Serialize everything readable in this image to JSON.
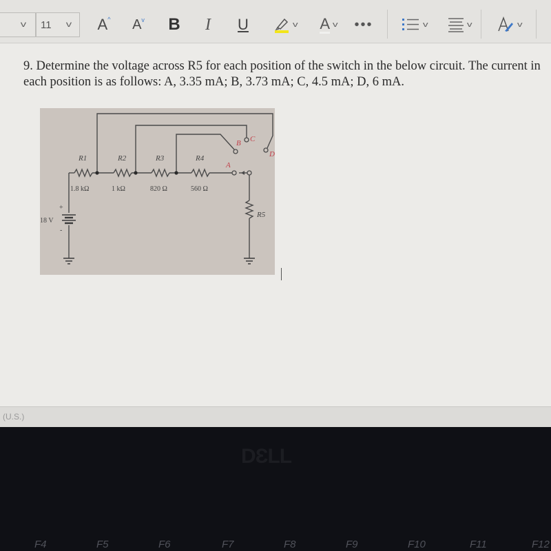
{
  "ribbon": {
    "font_name": "",
    "font_size": "11",
    "grow_font_label": "A",
    "shrink_font_label": "A",
    "bold_label": "B",
    "italic_label": "I",
    "underline_label": "U",
    "font_color_label": "A",
    "more_label": "•••",
    "styles_label": "A",
    "highlight_color": "#f2e51a",
    "accent_color": "#3d78c8"
  },
  "document": {
    "question": "9. Determine the voltage across R5 for each position of the switch in the below circuit.  The current in each position is as follows: A, 3.35 mA; B, 3.73 mA; C, 4.5 mA; D, 6 mA.",
    "figure": {
      "source_label": "18 V",
      "plus": "+",
      "minus": "-",
      "resistors": [
        {
          "name": "R1",
          "value": "1.8 kΩ"
        },
        {
          "name": "R2",
          "value": "1 kΩ"
        },
        {
          "name": "R3",
          "value": "820 Ω"
        },
        {
          "name": "R4",
          "value": "560 Ω"
        },
        {
          "name": "R5",
          "value": ""
        }
      ],
      "switch_positions": [
        "A",
        "B",
        "C",
        "D"
      ]
    }
  },
  "statusbar": {
    "language": "n (U.S.)"
  },
  "bezel": {
    "brand": "DƐLL",
    "fkeys": [
      "F4",
      "F5",
      "F6",
      "F7",
      "F8",
      "F9",
      "F10",
      "F11",
      "F12"
    ]
  }
}
